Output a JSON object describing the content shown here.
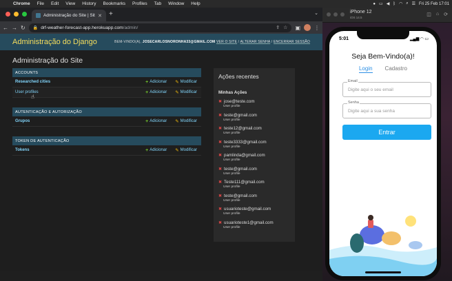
{
  "menubar": {
    "app": "Chrome",
    "items": [
      "File",
      "Edit",
      "View",
      "History",
      "Bookmarks",
      "Profiles",
      "Tab",
      "Window",
      "Help"
    ],
    "datetime": "Fri 25 Feb 17:01"
  },
  "browser": {
    "tab_title": "Administração do Site | Site de...",
    "url_host": "drf-weather-forecast-app.herokuapp.com",
    "url_path": "/admin/"
  },
  "django": {
    "brand": "Administração do Django",
    "welcome_prefix": "BEM-VINDO(A),",
    "username": "JOSECARLOSNORONHA33@GMAIL.COM",
    "links": [
      "VER O SITE",
      "ALTERAR SENHA",
      "ENCERRAR SESSÃO"
    ],
    "page_title": "Administração do Site",
    "add_label": "Adicionar",
    "change_label": "Modificar",
    "modules": [
      {
        "caption": "ACCOUNTS",
        "rows": [
          "Researched cities",
          "User profiles"
        ]
      },
      {
        "caption": "AUTENTICAÇÃO E AUTORIZAÇÃO",
        "rows": [
          "Grupos"
        ]
      },
      {
        "caption": "TOKEN DE AUTENTICAÇÃO",
        "rows": [
          "Tokens"
        ]
      }
    ],
    "recent": {
      "title": "Ações recentes",
      "subtitle": "Minhas Ações",
      "item_type": "User profile",
      "items": [
        "jose@teste.com",
        "teste@gmail.com",
        "teste12@gmail.com",
        "teste3333@gmail.com",
        "pamlinda@gmail.com",
        "teste@gmail.com",
        "Teste111@gmail.com",
        "teste@gmail.com",
        "usuarioteste@gmail.com",
        "usuarioteste1@gmail.com"
      ]
    }
  },
  "simulator": {
    "device": "iPhone 12",
    "os": "iOS 14.5",
    "time": "5:01",
    "welcome": "Seja Bem-Vindo(a)!",
    "tab_login": "Login",
    "tab_register": "Cadastro",
    "email_label": "Email",
    "email_placeholder": "Digite aqui o seu email",
    "password_label": "Senha",
    "password_placeholder": "Digite aqui a sua senha",
    "submit": "Entrar"
  }
}
